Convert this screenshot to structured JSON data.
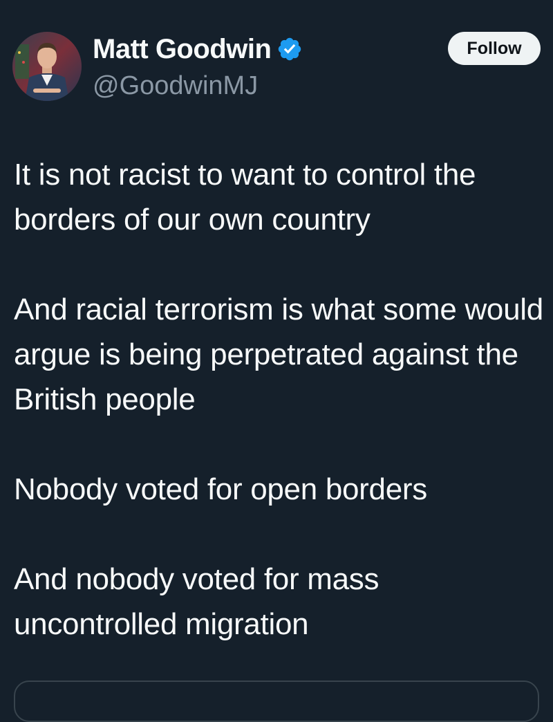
{
  "author": {
    "display_name": "Matt Goodwin",
    "handle": "@GoodwinMJ",
    "verified": true,
    "avatar_icon": "profile-photo",
    "verified_icon": "verified-badge-icon",
    "verified_color": "#1d9bf0"
  },
  "actions": {
    "follow_label": "Follow"
  },
  "tweet": {
    "paragraphs": [
      "It is not racist to want to control the borders of our own country",
      "And racial terrorism is what some would argue is being perpetrated against the British people",
      "Nobody voted for open borders",
      "And nobody voted for mass uncontrolled migration"
    ]
  },
  "colors": {
    "background": "#15202b",
    "text": "#f7f9f9",
    "muted": "#8b98a5",
    "follow_bg": "#eff3f4"
  }
}
